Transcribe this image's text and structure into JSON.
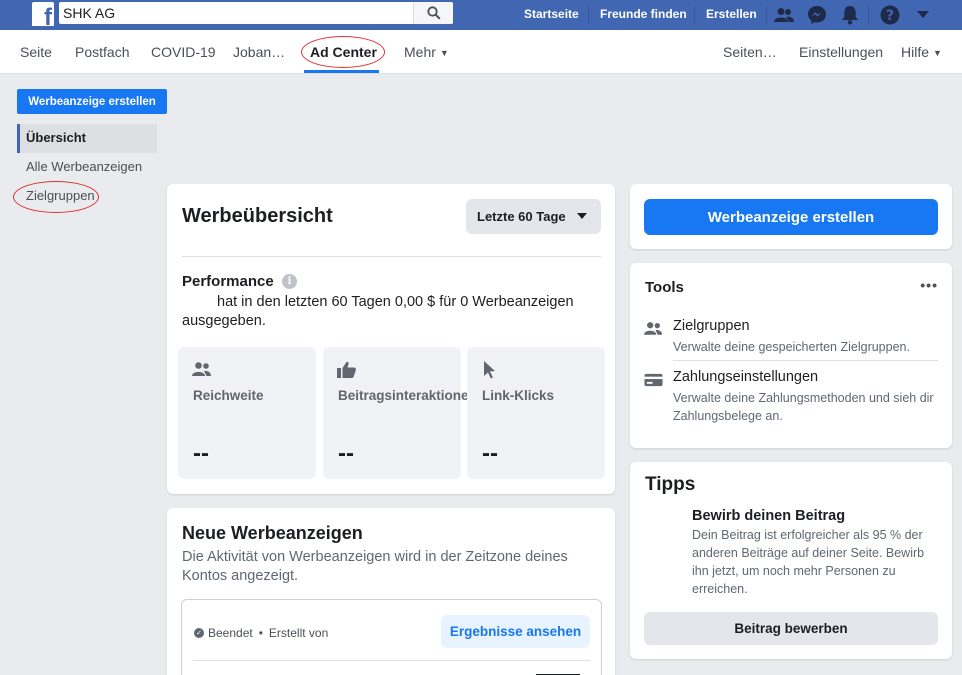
{
  "topbar": {
    "logo": "f",
    "search_value": "SHK AG",
    "links": [
      "Startseite",
      "Freunde finden",
      "Erstellen"
    ],
    "icons": [
      "friends-icon",
      "messenger-icon",
      "bell-icon",
      "help-icon",
      "caret-down-icon"
    ],
    "brand_color": "#4267b2"
  },
  "pagenav": {
    "left": [
      "Seite",
      "Postfach",
      "COVID-19",
      "Joban…",
      "Ad Center",
      "Mehr"
    ],
    "right": [
      "Seiten…",
      "Einstellungen",
      "Hilfe"
    ],
    "active": "Ad Center"
  },
  "leftcol": {
    "create_button": "Werbeanzeige erstellen",
    "items": [
      "Übersicht",
      "Alle Werbeanzeigen",
      "Zielgruppen"
    ],
    "active": "Übersicht"
  },
  "overview": {
    "title": "Werbeübersicht",
    "range": "Letzte 60 Tage",
    "performance_label": "Performance",
    "performance_text": "hat in den letzten 60 Tagen 0,00 $ für 0 Werbeanzeigen ausgegeben.",
    "metrics": [
      {
        "label": "Reichweite",
        "value": "--",
        "icon": "people-icon"
      },
      {
        "label": "Beitragsinteraktionen",
        "value": "--",
        "icon": "thumbs-up-icon"
      },
      {
        "label": "Link-Klicks",
        "value": "--",
        "icon": "cursor-icon"
      }
    ]
  },
  "neue": {
    "title": "Neue Werbeanzeigen",
    "subtitle": "Die Aktivität von Werbeanzeigen wird in der Zeitzone deines Kontos angezeigt.",
    "status": "Beendet",
    "created": "Erstellt von",
    "results_button": "Ergebnisse ansehen"
  },
  "right": {
    "create_button": "Werbeanzeige erstellen",
    "tools_title": "Tools",
    "tools": [
      {
        "name": "Zielgruppen",
        "desc": "Verwalte deine gespeicherten Zielgruppen.",
        "icon": "people-icon"
      },
      {
        "name": "Zahlungseinstellungen",
        "desc": "Verwalte deine Zahlungsmethoden und sieh dir Zahlungsbelege an.",
        "icon": "credit-card-icon"
      }
    ],
    "tipps_title": "Tipps",
    "tip_title": "Bewirb deinen Beitrag",
    "tip_text": "Dein Beitrag ist erfolgreicher als 95 % der anderen Beiträge auf deiner Seite. Bewirb ihn jetzt, um noch mehr Personen zu erreichen.",
    "tip_button": "Beitrag bewerben"
  },
  "colors": {
    "accent": "#1877f2",
    "annotation": "#dd3333"
  }
}
